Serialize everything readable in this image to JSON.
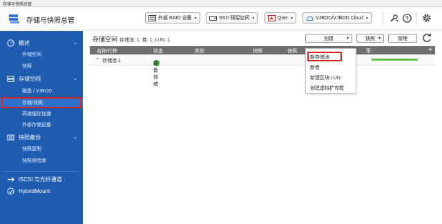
{
  "window": {
    "title": "存储与快照总管"
  },
  "header": {
    "app_title": "存储与快照总管",
    "buttons": [
      {
        "label": "外部 RAID 设备",
        "icon": "raid-device-icon"
      },
      {
        "label": "SSD 预留空间",
        "icon": "ssd-icon"
      },
      {
        "label": "Qtier",
        "icon": "qtier-icon"
      },
      {
        "label": "VJBOD/VJBOD Cloud",
        "icon": "cloud-icon"
      }
    ],
    "icons": [
      "tools-icon",
      "help-icon",
      "settings-icon"
    ]
  },
  "sidebar": {
    "sections": [
      {
        "label": "概述",
        "icon": "overview-icon",
        "items": [
          "存储空间",
          "快照"
        ]
      },
      {
        "label": "存储空间",
        "icon": "storage-icon",
        "items": [
          "磁盘 / VJBOD",
          "存储/快照",
          "高速缓存加速",
          "外部存储设备"
        ]
      },
      {
        "label": "快照备份",
        "icon": "snapshot-backup-icon",
        "items": [
          "快照复制",
          "快照保险库"
        ]
      }
    ],
    "bottom": [
      {
        "label": "iSCSI 与光纤通道",
        "icon": "iscsi-icon"
      },
      {
        "label": "HybridMount",
        "icon": "hybridmount-icon"
      }
    ],
    "active_item": "存储/快照"
  },
  "main": {
    "title": "存储空间",
    "subtitle": "存储池: 1, 卷: 1, LUN: 1",
    "toolbar": {
      "create": "创建",
      "snapshot": "快照",
      "manage": "管理"
    },
    "table": {
      "columns": [
        "名称/代称",
        "状态",
        "类型",
        "快照",
        "快照",
        "率"
      ],
      "rows": [
        {
          "name": "存储池 1",
          "status": "准备就绪",
          "usage_fraction": 0.9
        }
      ]
    },
    "create_menu": [
      "新存储池",
      "新卷",
      "新建区块 LUN",
      "创建虚拟扩充框"
    ]
  }
}
